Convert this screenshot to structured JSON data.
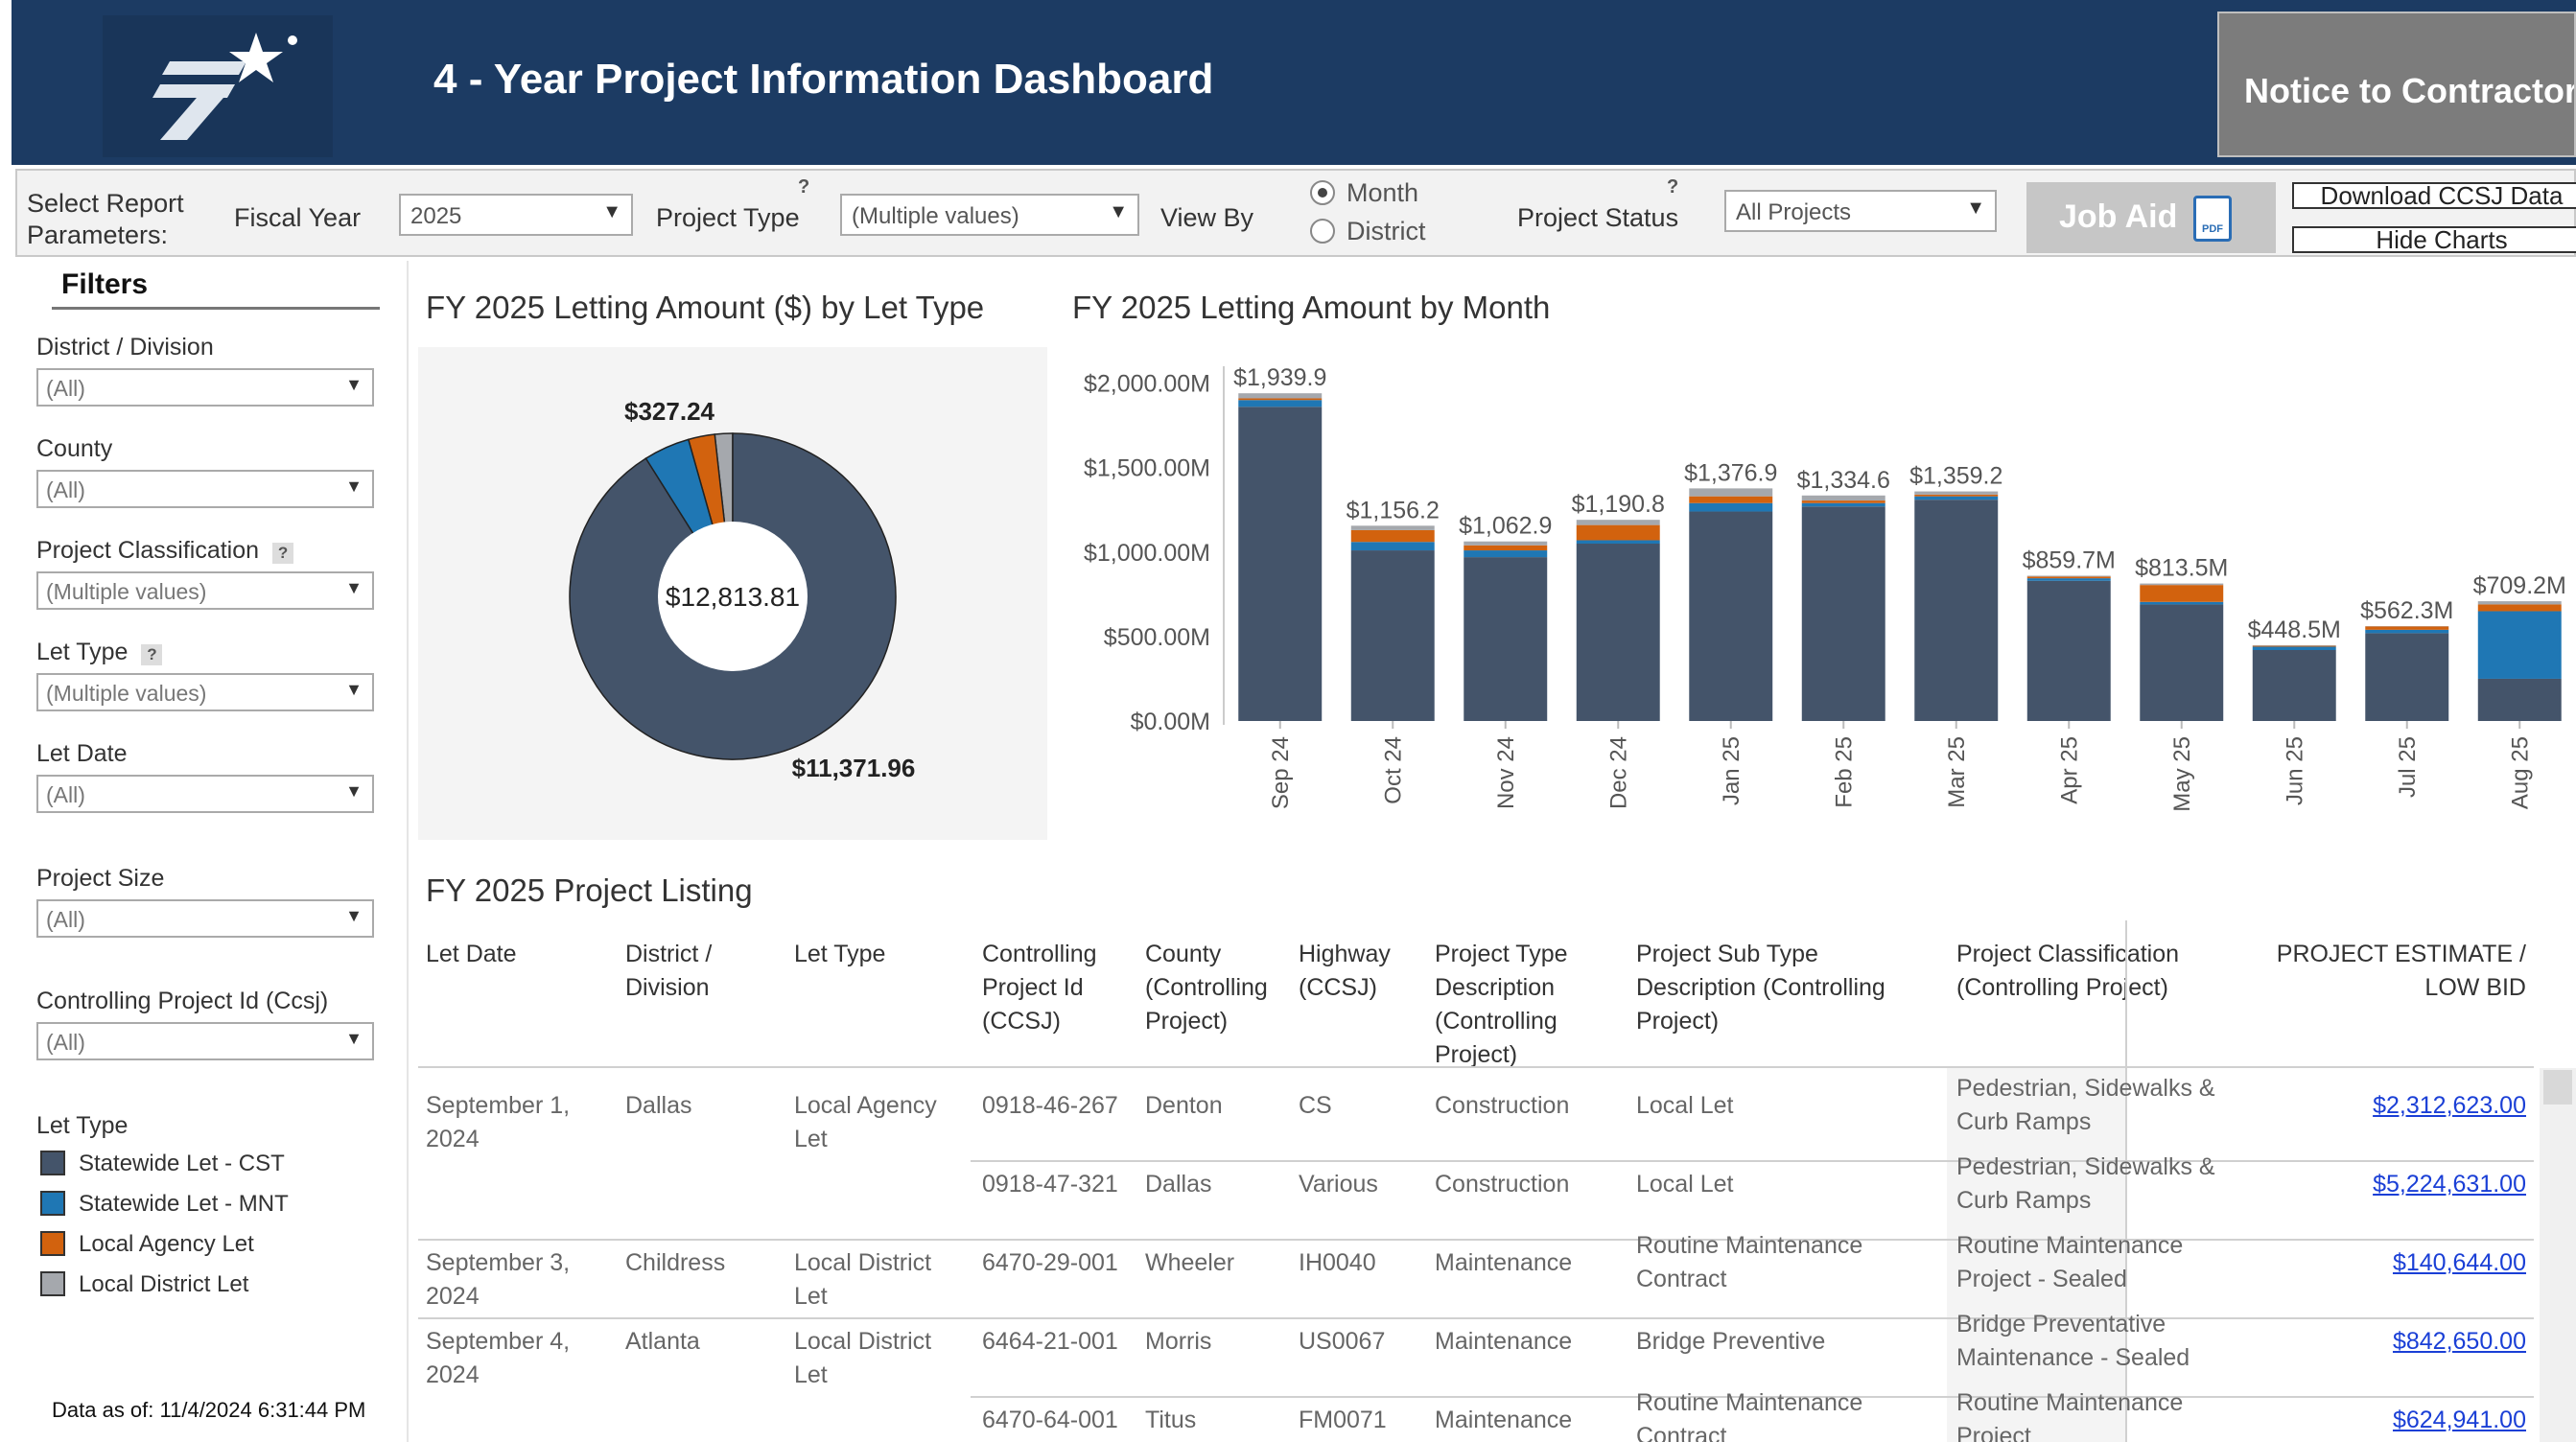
{
  "header": {
    "title": "4 - Year Project Information Dashboard",
    "notice_button": "Notice to Contractors"
  },
  "params": {
    "select_report_label": "Select Report Parameters:",
    "fiscal_year_label": "Fiscal Year",
    "fiscal_year_value": "2025",
    "project_type_label": "Project Type",
    "project_type_value": "(Multiple values)",
    "view_by_label": "View By",
    "view_by_options": [
      "Month",
      "District"
    ],
    "view_by_selected": "Month",
    "project_status_label": "Project Status",
    "project_status_value": "All Projects",
    "job_aid_label": "Job Aid",
    "download_label": "Download CCSJ Data",
    "hide_charts_label": "Hide Charts",
    "help_mark": "?"
  },
  "filters": {
    "title": "Filters",
    "items": [
      {
        "label": "District / Division",
        "value": "(All)",
        "help": false
      },
      {
        "label": "County",
        "value": "(All)",
        "help": false
      },
      {
        "label": "Project Classification",
        "value": "(Multiple values)",
        "help": true
      },
      {
        "label": "Let Type",
        "value": "(Multiple values)",
        "help": true
      },
      {
        "label": "Let Date",
        "value": "(All)",
        "help": false
      },
      {
        "label": "Project Size",
        "value": "(All)",
        "help": false
      },
      {
        "label": "Controlling Project Id (Ccsj)",
        "value": "(All)",
        "help": false
      }
    ],
    "legend_title": "Let Type",
    "legend": [
      {
        "label": "Statewide Let - CST",
        "color": "#44546a"
      },
      {
        "label": "Statewide Let - MNT",
        "color": "#1f77b4"
      },
      {
        "label": "Local Agency Let",
        "color": "#d2620e"
      },
      {
        "label": "Local District Let",
        "color": "#a5a8ad"
      }
    ],
    "data_as_of": "Data as of: 11/4/2024 6:31:44 PM"
  },
  "chart_data": [
    {
      "type": "pie",
      "title": "FY 2025 Letting Amount ($) by Let Type",
      "center_label": "$12,813.81",
      "slices": [
        {
          "name": "Statewide Let - CST",
          "value": 11371.96,
          "label": "$11,371.96",
          "color": "#44546a"
        },
        {
          "name": "Statewide Let - MNT",
          "value": 570,
          "label": "",
          "color": "#1f77b4"
        },
        {
          "name": "Local Agency Let",
          "value": 327.24,
          "label": "$327.24",
          "color": "#d2620e"
        },
        {
          "name": "Local District Let",
          "value": 220,
          "label": "",
          "color": "#a5a8ad"
        }
      ]
    },
    {
      "type": "bar",
      "stacked": true,
      "title": "FY 2025  Letting Amount by Month",
      "categories": [
        "Sep 24",
        "Oct 24",
        "Nov 24",
        "Dec 24",
        "Jan 25",
        "Feb 25",
        "Mar 25",
        "Apr 25",
        "May 25",
        "Jun 25",
        "Jul 25",
        "Aug 25"
      ],
      "totals_labels": [
        "$1,939.9",
        "$1,156.2",
        "$1,062.9",
        "$1,190.8",
        "$1,376.9",
        "$1,334.6",
        "$1,359.2",
        "$859.7M",
        "$813.5M",
        "$448.5M",
        "$562.3M",
        "$709.2M"
      ],
      "yticks": [
        "$0.00M",
        "$500.00M",
        "$1,000.00M",
        "$1,500.00M",
        "$2,000.00M"
      ],
      "ylim": [
        0,
        2100
      ],
      "series": [
        {
          "name": "Statewide Let - CST",
          "color": "#44546a",
          "values": [
            1860,
            1010,
            970,
            1050,
            1240,
            1270,
            1310,
            830,
            690,
            420,
            520,
            250
          ]
        },
        {
          "name": "Statewide Let - MNT",
          "color": "#1f77b4",
          "values": [
            40,
            50,
            40,
            20,
            50,
            20,
            20,
            15,
            15,
            20,
            20,
            400
          ]
        },
        {
          "name": "Local Agency Let",
          "color": "#d2620e",
          "values": [
            10,
            70,
            30,
            90,
            40,
            15,
            10,
            10,
            100,
            5,
            20,
            40
          ]
        },
        {
          "name": "Local District Let",
          "color": "#a5a8ad",
          "values": [
            30,
            26,
            23,
            31,
            47,
            30,
            19,
            5,
            9,
            4,
            2,
            19
          ]
        }
      ]
    }
  ],
  "listing": {
    "title": "FY 2025 Project Listing",
    "columns": [
      "Let Date",
      "District /\nDivision",
      "Let Type",
      "Controlling\nProject Id\n(CCSJ)",
      "County\n(Controlling\nProject)",
      "Highway\n(CCSJ)",
      "Project Type\nDescription\n(Controlling\nProject)",
      "Project Sub Type\nDescription (Controlling\nProject)",
      "Project Classification\n(Controlling Project)",
      "PROJECT ESTIMATE /\nLOW BID"
    ],
    "rows": [
      {
        "let_date": "September 1,\n2024",
        "district": "Dallas",
        "let_type": "Local Agency\nLet",
        "ccsj": "0918-46-267",
        "county": "Denton",
        "highway": "CS",
        "ptype": "Construction",
        "subtype": "Local Let",
        "classification": "Pedestrian, Sidewalks &\nCurb Ramps",
        "amount": "$2,312,623.00"
      },
      {
        "let_date": "",
        "district": "",
        "let_type": "",
        "ccsj": "0918-47-321",
        "county": "Dallas",
        "highway": "Various",
        "ptype": "Construction",
        "subtype": "Local Let",
        "classification": "Pedestrian, Sidewalks &\nCurb Ramps",
        "amount": "$5,224,631.00"
      },
      {
        "let_date": "September 3,\n2024",
        "district": "Childress",
        "let_type": "Local District\nLet",
        "ccsj": "6470-29-001",
        "county": "Wheeler",
        "highway": "IH0040",
        "ptype": "Maintenance",
        "subtype": "Routine Maintenance\nContract",
        "classification": "Routine Maintenance\nProject - Sealed",
        "amount": "$140,644.00"
      },
      {
        "let_date": "September 4,\n2024",
        "district": "Atlanta",
        "let_type": "Local District\nLet",
        "ccsj": "6464-21-001",
        "county": "Morris",
        "highway": "US0067",
        "ptype": "Maintenance",
        "subtype": "Bridge Preventive",
        "classification": "Bridge Preventative\nMaintenance - Sealed",
        "amount": "$842,650.00"
      },
      {
        "let_date": "",
        "district": "",
        "let_type": "",
        "ccsj": "6470-64-001",
        "county": "Titus",
        "highway": "FM0071",
        "ptype": "Maintenance",
        "subtype": "Routine Maintenance\nContract",
        "classification": "Routine Maintenance\nProject",
        "amount": "$624,941.00"
      }
    ]
  }
}
